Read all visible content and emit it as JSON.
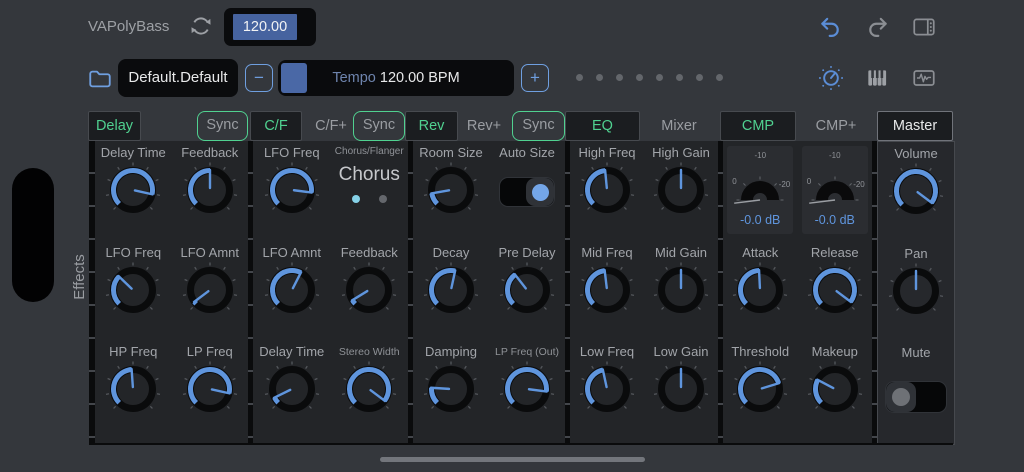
{
  "header": {
    "preset_name": "VAPolyBass",
    "bpm_field": "120.00",
    "bank_name": "Default.Default",
    "tempo_label": "Tempo",
    "tempo_value": "120.00 BPM",
    "page_dot_count": 8
  },
  "tabs": [
    {
      "label": "Delay",
      "style": "active"
    },
    {
      "label": "Sync",
      "style": "sync"
    },
    {
      "label": "C/F",
      "style": "active"
    },
    {
      "label": "C/F+",
      "style": "plain"
    },
    {
      "label": "Sync",
      "style": "sync"
    },
    {
      "label": "Rev",
      "style": "active"
    },
    {
      "label": "Rev+",
      "style": "plain"
    },
    {
      "label": "Sync",
      "style": "sync"
    },
    {
      "label": "EQ",
      "style": "active"
    },
    {
      "label": "Mixer",
      "style": "plain"
    },
    {
      "label": "CMP",
      "style": "active"
    },
    {
      "label": "CMP+",
      "style": "plain"
    },
    {
      "label": "Master",
      "style": "selected"
    }
  ],
  "side": {
    "section_label": "Effects"
  },
  "panels": [
    {
      "id": "delay",
      "cells": [
        {
          "type": "knob",
          "label": "Delay Time",
          "value": 0.88,
          "mode": "min"
        },
        {
          "type": "knob",
          "label": "Feedback",
          "value": 0.5,
          "mode": "min"
        },
        {
          "type": "knob",
          "label": "LFO Freq",
          "value": 0.33,
          "mode": "min"
        },
        {
          "type": "knob",
          "label": "LFO Amnt",
          "value": 0.03,
          "mode": "min"
        },
        {
          "type": "knob",
          "label": "HP Freq",
          "value": 0.485,
          "mode": "min"
        },
        {
          "type": "knob",
          "label": "LP Freq",
          "value": 0.88,
          "mode": "min"
        }
      ]
    },
    {
      "id": "chorus-flanger",
      "cells": [
        {
          "type": "knob",
          "label": "LFO Freq",
          "value": 0.86,
          "mode": "min"
        },
        {
          "type": "selector",
          "header": "Chorus/Flanger",
          "value": "Chorus",
          "dot_count": 2,
          "active_dot": 0
        },
        {
          "type": "knob",
          "label": "LFO Amnt",
          "value": 0.6,
          "mode": "min"
        },
        {
          "type": "knob",
          "label": "Feedback",
          "value": 0.05,
          "mode": "min"
        },
        {
          "type": "knob",
          "label": "Delay Time",
          "value": 0.07,
          "mode": "min"
        },
        {
          "type": "knob",
          "label": "Stereo Width",
          "value": 0.97,
          "mode": "min",
          "small": true
        }
      ]
    },
    {
      "id": "reverb",
      "cells": [
        {
          "type": "knob",
          "label": "Room Size",
          "value": 0.13,
          "mode": "min"
        },
        {
          "type": "toggle",
          "label": "Auto Size",
          "on": true
        },
        {
          "type": "knob",
          "label": "Decay",
          "value": 0.545,
          "mode": "min"
        },
        {
          "type": "knob",
          "label": "Pre Delay",
          "value": 0.36,
          "mode": "min"
        },
        {
          "type": "knob",
          "label": "Damping",
          "value": 0.18,
          "mode": "min"
        },
        {
          "type": "knob",
          "label": "LP Freq (Out)",
          "value": 0.86,
          "mode": "min",
          "small": true
        }
      ]
    },
    {
      "id": "eq",
      "cells": [
        {
          "type": "knob",
          "label": "High Freq",
          "value": 0.48,
          "mode": "min"
        },
        {
          "type": "knob",
          "label": "High Gain",
          "value": 0.5,
          "mode": "center"
        },
        {
          "type": "knob",
          "label": "Mid Freq",
          "value": 0.475,
          "mode": "min"
        },
        {
          "type": "knob",
          "label": "Mid Gain",
          "value": 0.5,
          "mode": "center"
        },
        {
          "type": "knob",
          "label": "Low Freq",
          "value": 0.455,
          "mode": "min"
        },
        {
          "type": "knob",
          "label": "Low Gain",
          "value": 0.5,
          "mode": "center"
        }
      ]
    },
    {
      "id": "compressor",
      "cells": [
        {
          "type": "meter",
          "scale_top": "-10",
          "scale_left": "0",
          "scale_right": "-20",
          "readout": "-0.0 dB"
        },
        {
          "type": "meter",
          "scale_top": "-10",
          "scale_left": "0",
          "scale_right": "-20",
          "readout": "-0.0 dB"
        },
        {
          "type": "knob",
          "label": "Attack",
          "value": 0.49,
          "mode": "min"
        },
        {
          "type": "knob",
          "label": "Release",
          "value": 0.97,
          "mode": "min"
        },
        {
          "type": "knob",
          "label": "Threshold",
          "value": 0.77,
          "mode": "min"
        },
        {
          "type": "knob",
          "label": "Makeup",
          "value": 0.27,
          "mode": "min"
        }
      ]
    },
    {
      "id": "master",
      "single": true,
      "cells": [
        {
          "type": "knob",
          "label": "Volume",
          "value": 0.97,
          "mode": "min"
        },
        {
          "type": "knob",
          "label": "Pan",
          "value": 0.5,
          "mode": "center"
        },
        {
          "type": "toggle",
          "label": "Mute",
          "on": false
        }
      ]
    }
  ],
  "colors": {
    "accent_blue": "#5f95dd",
    "accent_green": "#50d190",
    "selection_blue": "#46639f",
    "selector_dot_active": "#86d2e8"
  }
}
